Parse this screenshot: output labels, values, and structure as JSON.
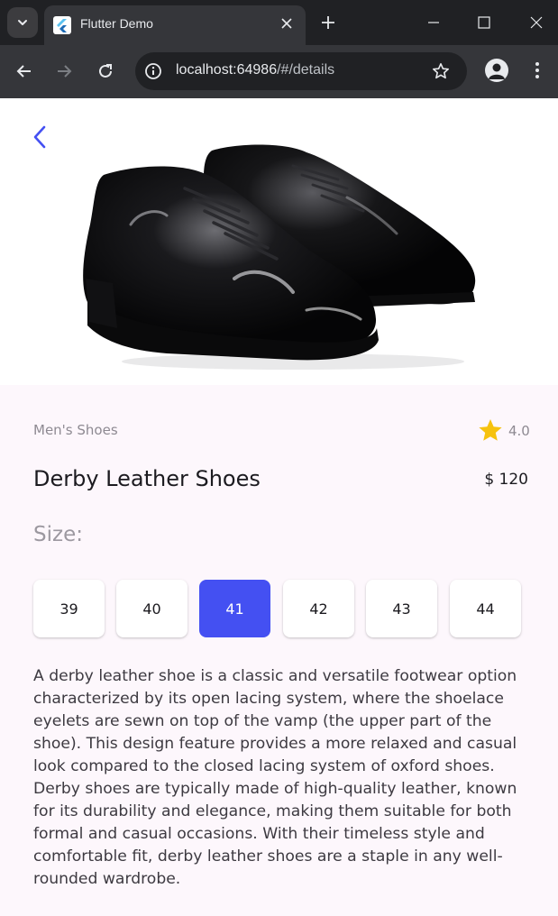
{
  "browser": {
    "tab_title": "Flutter Demo",
    "url_host": "localhost:64986",
    "url_path": "/#/details",
    "icons": {
      "tab_search": "chevron-down-icon",
      "favicon": "flutter-icon",
      "close_tab": "close-icon",
      "new_tab": "plus-icon",
      "minimize": "minimize-icon",
      "maximize": "maximize-icon",
      "close_window": "close-icon",
      "back": "arrow-left-icon",
      "forward": "arrow-right-icon",
      "reload": "reload-icon",
      "site_info": "info-icon",
      "bookmark": "star-outline-icon",
      "profile": "account-icon",
      "menu": "kebab-icon"
    }
  },
  "product": {
    "category": "Men's Shoes",
    "rating": "4.0",
    "name": "Derby Leather Shoes",
    "price": "$ 120",
    "size_label": "Size:",
    "sizes": [
      "39",
      "40",
      "41",
      "42",
      "43",
      "44"
    ],
    "selected_size": "41",
    "description": "A derby leather shoe is a classic and versatile footwear option characterized by its open lacing system, where the shoelace eyelets are sewn on top of the vamp (the upper part of the shoe). This design feature provides a more relaxed and casual look compared to the closed lacing system of oxford shoes. Derby shoes are typically made of high-quality leather, known for its durability and elegance, making them suitable for both formal and casual occasions. With their timeless style and comfortable fit, derby leather shoes are a staple in any well-rounded wardrobe."
  },
  "colors": {
    "accent": "#4450f2",
    "star": "#f6c20e",
    "page_bg": "#fdf7fc"
  }
}
